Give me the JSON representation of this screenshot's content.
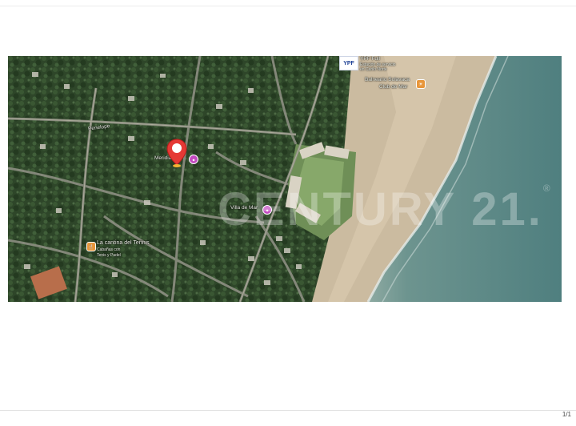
{
  "page": {
    "page_number": "1/1"
  },
  "map": {
    "watermark": "CENTURY 21.",
    "watermark_registered": "®",
    "labels": {
      "penelope": "Penelope",
      "meridiano": "Meridiano",
      "villa_de_mar": "Villa de Mar",
      "la_cantina": "La cantina del Tennis",
      "cabanas": "Cabañas con",
      "tenis_padel": "Tenis y Padel",
      "ypf_text": "YPF Full",
      "ypf_sub1": "Estación de servicio",
      "ypf_sub2": "en Carilo Norte",
      "balneario": "Balneario Solavaca",
      "club": "Club de Mar",
      "ypf_logo": "YPF"
    },
    "marker_icon": "map-pin-icon",
    "colors": {
      "marker": "#e53935",
      "sea": "#5e8a88",
      "sand": "#cdbda4",
      "forest": "#2f4a2b"
    }
  }
}
